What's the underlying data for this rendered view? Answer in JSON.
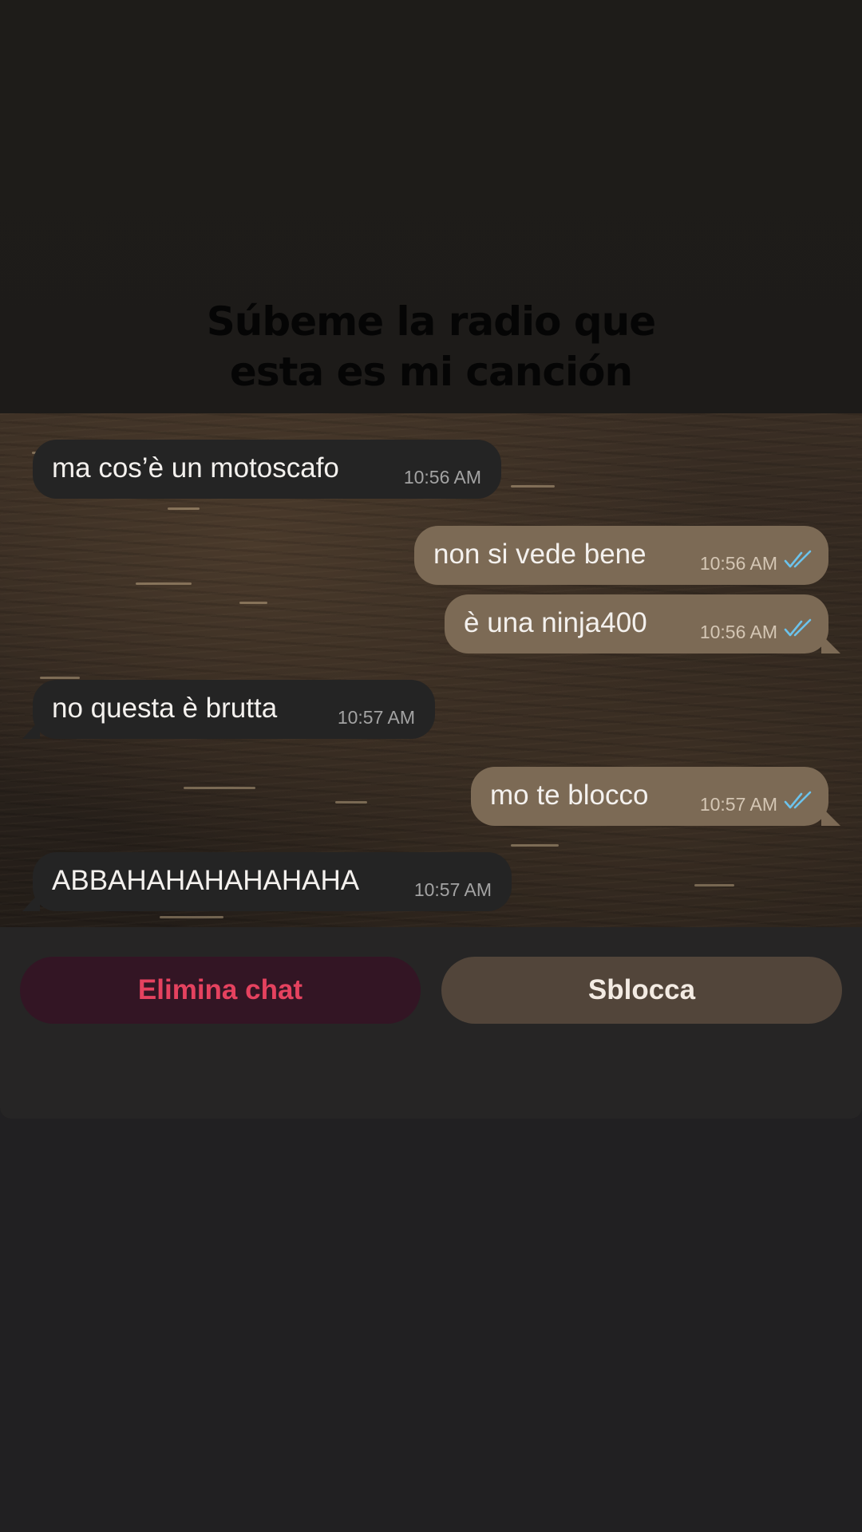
{
  "song_caption": {
    "line1": "Súbeme la radio que",
    "line2": "esta es mi canción"
  },
  "messages": [
    {
      "direction": "incoming",
      "text": "ma cos’è un motoscafo",
      "time": "10:56 AM"
    },
    {
      "direction": "outgoing",
      "text": "non si vede bene",
      "time": "10:56 AM",
      "read": true
    },
    {
      "direction": "outgoing",
      "text": "è una ninja400",
      "time": "10:56 AM",
      "read": true
    },
    {
      "direction": "incoming",
      "text": "no questa è brutta",
      "time": "10:57 AM"
    },
    {
      "direction": "outgoing",
      "text": "mo te blocco",
      "time": "10:57 AM",
      "read": true
    },
    {
      "direction": "incoming",
      "text": "ABBAHAHAHAHAHAHA",
      "time": "10:57 AM"
    }
  ],
  "actions": {
    "delete_label": "Elimina chat",
    "unblock_label": "Sblocca"
  },
  "icons": {
    "read_receipt": "double-check-icon"
  },
  "colors": {
    "incoming_bubble": "#242424",
    "outgoing_bubble": "#7c6a55",
    "read_check": "#6cc3ec",
    "delete_text": "#e5425f",
    "delete_background": "#331524",
    "unblock_background": "#52453a"
  }
}
